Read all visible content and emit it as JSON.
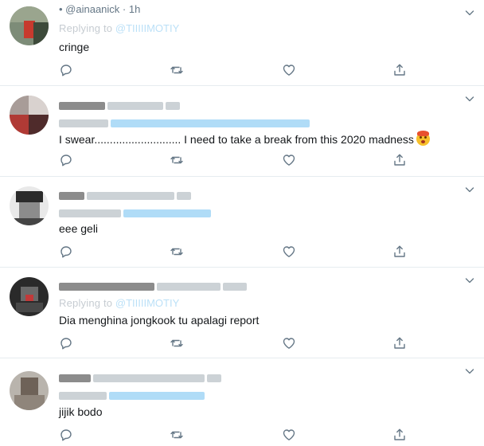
{
  "tweets": [
    {
      "header": "• @ainaanick · 1h",
      "replying_label": "Replying to",
      "replying_handle": "@TIIIIIMOTIY",
      "text": "cringe",
      "has_emoji": false
    },
    {
      "header": "",
      "replying_label": "",
      "replying_handle": "",
      "text": "I swear............................ I need to take a break from this 2020 madness",
      "has_emoji": true,
      "emoji": "exploding-head"
    },
    {
      "header": "",
      "replying_label": "",
      "replying_handle": "",
      "text": "eee geli",
      "has_emoji": false
    },
    {
      "header": "",
      "replying_label": "Replying to",
      "replying_handle": "@TIIIIIMOTIY",
      "text": "Dia menghina jongkook tu apalagi report",
      "has_emoji": false
    },
    {
      "header": "",
      "replying_label": "",
      "replying_handle": "",
      "text": "jijik bodo",
      "has_emoji": false
    }
  ],
  "icons": {
    "reply": "reply-icon",
    "retweet": "retweet-icon",
    "like": "like-icon",
    "share": "share-icon",
    "more": "chevron-down-icon"
  },
  "colors": {
    "icon": "#657786",
    "link": "#1da1f2",
    "divider": "#e6ecf0",
    "text": "#14171a"
  }
}
